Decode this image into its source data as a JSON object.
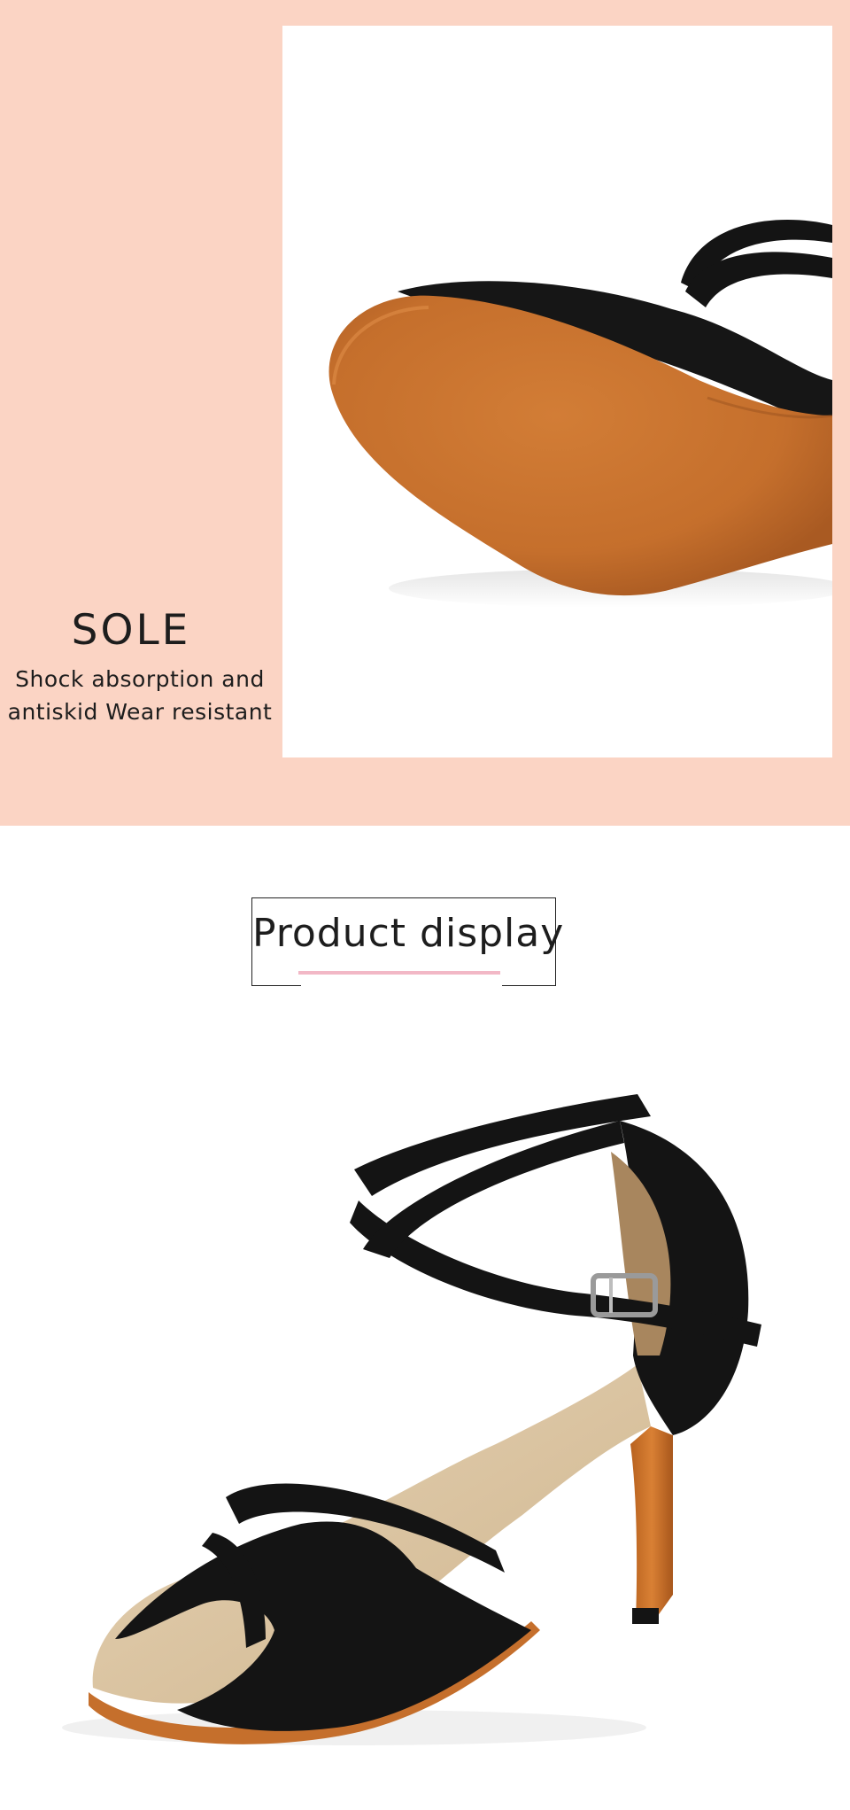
{
  "sole": {
    "title": "SOLE",
    "line1": "Shock absorption and",
    "line2": "antiskid Wear resistant",
    "photo_alt": "dance shoe suede sole close-up"
  },
  "display": {
    "title": "Product display",
    "photo_alt": "black suede latin dance sandal with criss-cross ankle straps"
  },
  "colors": {
    "background_peach": "#fbd4c4",
    "accent_pink": "#f2b8c6",
    "suede_black": "#141414",
    "sole_orange": "#c9732e",
    "lining_beige": "#dcc4a2"
  }
}
